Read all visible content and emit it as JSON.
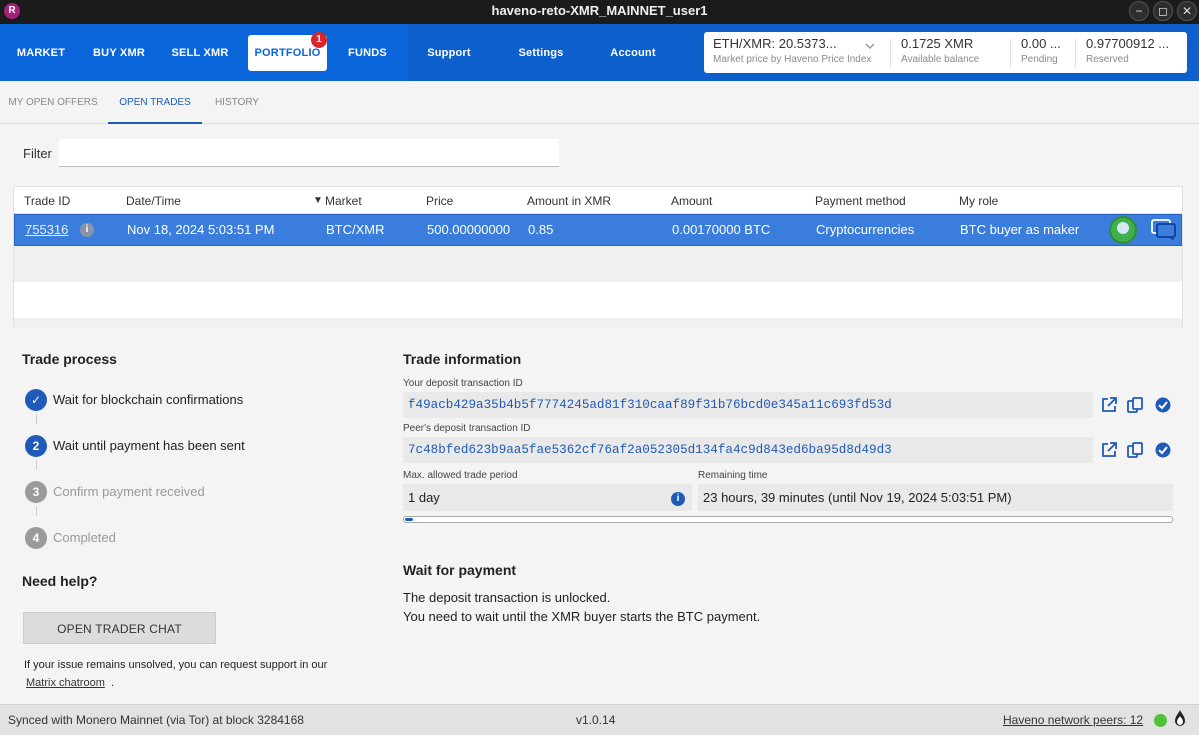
{
  "window": {
    "app_icon": "R",
    "title": "haveno-reto-XMR_MAINNET_user1",
    "buttons": [
      "minimize-icon",
      "maximize-icon",
      "close-icon"
    ]
  },
  "nav": {
    "items": [
      {
        "label": "MARKET"
      },
      {
        "label": "BUY XMR"
      },
      {
        "label": "SELL XMR"
      },
      {
        "label": "PORTFOLIO",
        "active": true,
        "badge": "1"
      },
      {
        "label": "FUNDS"
      },
      {
        "label": "Support"
      },
      {
        "label": "Settings"
      },
      {
        "label": "Account"
      }
    ],
    "price": {
      "value": "ETH/XMR: 20.5373...",
      "label": "Market price by Haveno Price Index"
    },
    "available": {
      "value": "0.1725 XMR",
      "label": "Available balance"
    },
    "pending": {
      "value": "0.00 ...",
      "label": "Pending"
    },
    "reserved": {
      "value": "0.97700912 ...",
      "label": "Reserved"
    }
  },
  "subtabs": [
    {
      "label": "MY OPEN OFFERS"
    },
    {
      "label": "OPEN TRADES",
      "active": true
    },
    {
      "label": "HISTORY"
    }
  ],
  "filter": {
    "label": "Filter",
    "value": "",
    "placeholder": ""
  },
  "table": {
    "columns": [
      "Trade ID",
      "Date/Time",
      "Market",
      "Price",
      "Amount in XMR",
      "Amount",
      "Payment method",
      "My role"
    ],
    "sort_indicator": "▼",
    "rows": [
      {
        "trade_id": "755316",
        "info_icon": "i",
        "datetime": "Nov 18, 2024 5:03:51 PM",
        "market": "BTC/XMR",
        "price": "500.00000000",
        "amount_xmr": "0.85",
        "amount": "0.00170000 BTC",
        "payment_method": "Cryptocurrencies",
        "role": "BTC buyer as maker"
      }
    ]
  },
  "trade_process": {
    "title": "Trade process",
    "steps": [
      {
        "marker": "✓",
        "label": "Wait for blockchain confirmations",
        "state": "done"
      },
      {
        "marker": "2",
        "label": "Wait until payment has been sent",
        "state": "current"
      },
      {
        "marker": "3",
        "label": "Confirm payment received",
        "state": "todo"
      },
      {
        "marker": "4",
        "label": "Completed",
        "state": "todo"
      }
    ],
    "help_title": "Need help?",
    "chat_button": "OPEN TRADER CHAT",
    "help_text": "If your issue remains unsolved, you can request support in our",
    "help_link": "Matrix chatroom",
    "help_suffix": "."
  },
  "trade_info": {
    "title": "Trade information",
    "your_deposit_label": "Your deposit transaction ID",
    "your_deposit_id": "f49acb429a35b4b5f7774245ad81f310caaf89f31b76bcd0e345a11c693fd53d",
    "peer_deposit_label": "Peer's deposit transaction ID",
    "peer_deposit_id": "7c48bfed623b9aa5fae5362cf76af2a052305d134fa4c9d843ed6ba95d8d49d3",
    "max_period_label": "Max. allowed trade period",
    "max_period_value": "1 day",
    "remaining_label": "Remaining time",
    "remaining_value": "23 hours, 39 minutes (until Nov 19, 2024 5:03:51 PM)",
    "progress": 0.01,
    "wait_title": "Wait for payment",
    "wait_line1": "The deposit transaction is unlocked.",
    "wait_line2": "You need to wait until the XMR buyer starts the BTC payment."
  },
  "footer": {
    "sync": "Synced with Monero Mainnet (via Tor) at block 3284168",
    "version": "v1.0.14",
    "peers": "Haveno network peers: 12"
  },
  "colors": {
    "nav_blue": "#0b65da",
    "accent": "#1f5ab8",
    "selected_row": "#3b7ddd",
    "status_green": "#4fc13a",
    "badge_red": "#d9262b"
  }
}
